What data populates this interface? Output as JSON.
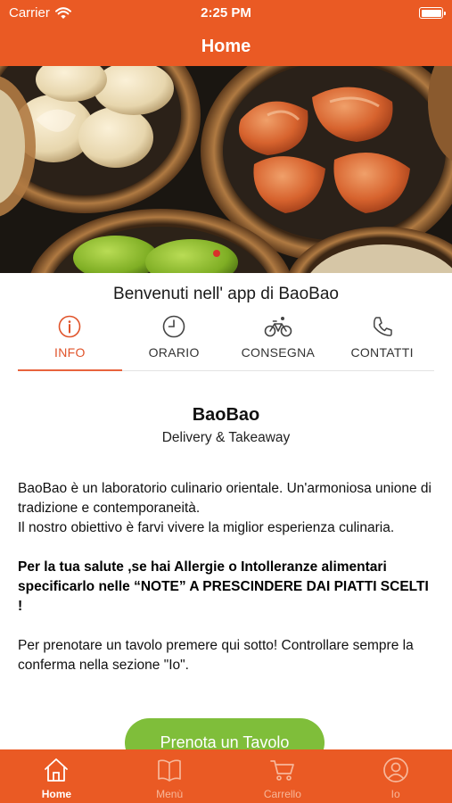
{
  "status_bar": {
    "carrier": "Carrier",
    "time": "2:25 PM"
  },
  "nav": {
    "title": "Home"
  },
  "welcome": "Benvenuti nell' app di BaoBao",
  "tabs": [
    {
      "label": "INFO",
      "icon": "info-icon",
      "active": true
    },
    {
      "label": "ORARIO",
      "icon": "clock-icon",
      "active": false
    },
    {
      "label": "CONSEGNA",
      "icon": "bicycle-icon",
      "active": false
    },
    {
      "label": "CONTATTI",
      "icon": "phone-icon",
      "active": false
    }
  ],
  "info": {
    "name": "BaoBao",
    "subtitle": "Delivery & Takeaway",
    "description_1": "BaoBao è un laboratorio culinario orientale. Un'armoniosa unione di tradizione e contemporaneità.",
    "description_2": "Il nostro obiettivo è farvi vivere la miglior esperienza culinaria.",
    "allergy_note": "Per la tua salute ,se hai Allergie o Intolleranze alimentari specificarlo nelle “NOTE” A PRESCINDERE DAI PIATTI SCELTI !",
    "booking_note": "Per prenotare un tavolo premere qui sotto! Controllare sempre la conferma nella sezione \"Io\"."
  },
  "book_button": "Prenota un Tavolo",
  "bottom_tabs": [
    {
      "label": "Home",
      "icon": "home-icon",
      "active": true
    },
    {
      "label": "Menù",
      "icon": "book-icon",
      "active": false
    },
    {
      "label": "Carrello",
      "icon": "cart-icon",
      "active": false
    },
    {
      "label": "Io",
      "icon": "user-icon",
      "active": false
    }
  ],
  "colors": {
    "brand": "#ea5a24",
    "tab_active": "#e0532a",
    "button": "#7fbe3a",
    "bottom_inactive": "#f7b79a"
  }
}
